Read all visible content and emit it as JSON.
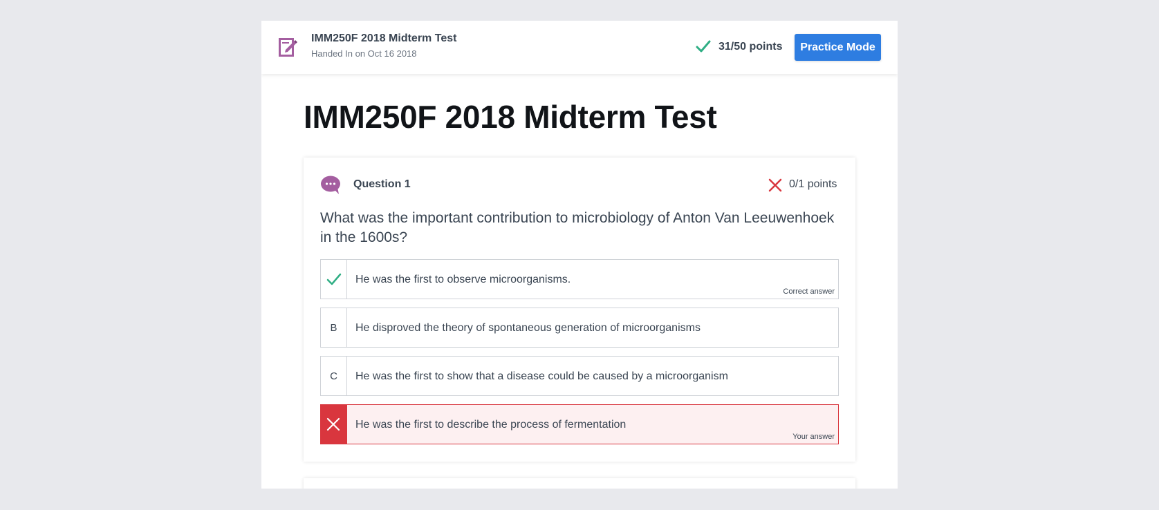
{
  "header": {
    "quiz_title": "IMM250F 2018 Midterm Test",
    "subtitle": "Handed In on Oct 16 2018",
    "score": "31/50 points",
    "practice_button": "Practice Mode",
    "icon": "quiz-pencil-icon"
  },
  "page": {
    "title": "IMM250F 2018 Midterm Test"
  },
  "question": {
    "label": "Question 1",
    "points": "0/1 points",
    "text": "What was the important contribution to microbiology of Anton Van Leeuwenhoek in the 1600s?",
    "icon": "speech-bubble-icon",
    "options": [
      {
        "marker": "",
        "marker_icon": "check-icon",
        "text": "He was the first to observe microorganisms.",
        "note": "Correct answer",
        "state": "correct"
      },
      {
        "marker": "B",
        "text": "He disproved the theory of spontaneous generation of microorganisms",
        "note": "",
        "state": "neutral"
      },
      {
        "marker": "C",
        "text": "He was the first to show that a disease could be caused by a microorganism",
        "note": "",
        "state": "neutral"
      },
      {
        "marker": "",
        "marker_icon": "x-icon",
        "text": "He was the first to describe the process of fermentation",
        "note": "Your answer",
        "state": "wrong"
      }
    ]
  },
  "colors": {
    "accent_blue": "#2e7de1",
    "correct_green": "#2fae84",
    "wrong_red": "#d9363e",
    "brand_purple": "#a45ea0",
    "background": "#e8e9ed"
  }
}
